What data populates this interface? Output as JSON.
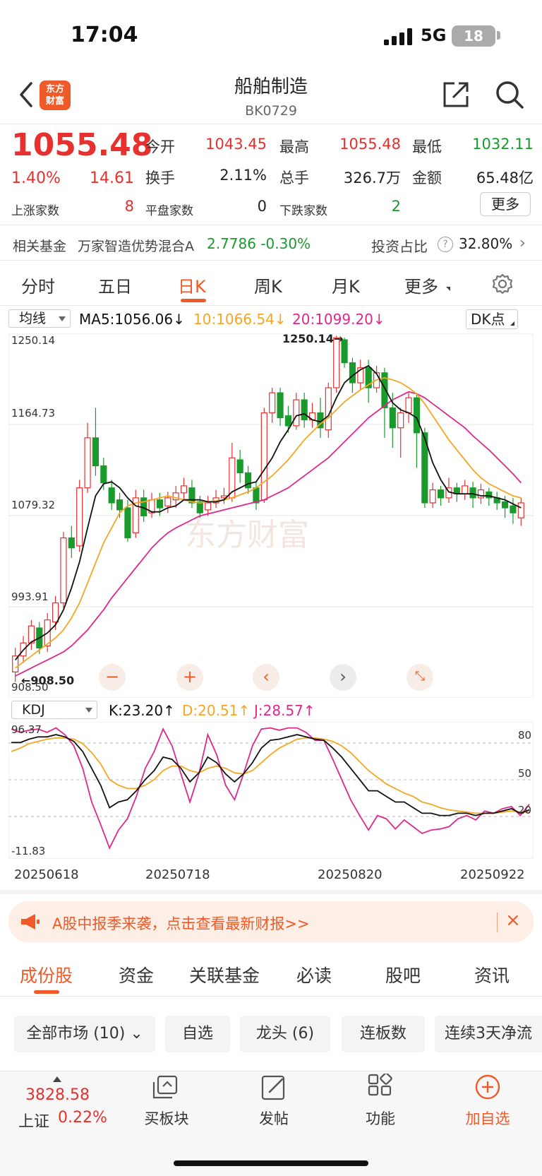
{
  "status": {
    "time": "17:04",
    "network": "5G",
    "battery": "18"
  },
  "header": {
    "title": "船舶制造",
    "code": "BK0729",
    "logo_line1": "东方",
    "logo_line2": "财富"
  },
  "quote": {
    "price": "1055.48",
    "change_pct": "1.40%",
    "change": "14.61",
    "open_label": "今开",
    "open": "1043.45",
    "high_label": "最高",
    "high": "1055.48",
    "low_label": "最低",
    "low": "1032.11",
    "turnover_label": "换手",
    "turnover": "2.11%",
    "volume_label": "总手",
    "volume": "326.7万",
    "amount_label": "金额",
    "amount": "65.48亿",
    "up_label": "上涨家数",
    "up": "8",
    "flat_label": "平盘家数",
    "flat": "0",
    "down_label": "下跌家数",
    "down": "2",
    "more": "更多"
  },
  "fund": {
    "label": "相关基金",
    "name": "万家智造优势混合A",
    "value": "2.7786 -0.30%",
    "ratio_label": "投资占比",
    "ratio": "32.80%"
  },
  "period_tabs": [
    "分时",
    "五日",
    "日K",
    "周K",
    "月K",
    "更多"
  ],
  "chart": {
    "ma_select": "均线",
    "ma5": "MA5:1056.06↓",
    "ma10": "10:1066.54↓",
    "ma20": "20:1099.20↓",
    "dk": "DK点",
    "price_ticks": [
      "1250.14",
      "1164.73",
      "1079.32",
      "993.91",
      "908.50"
    ],
    "high_marker": "1250.14",
    "low_marker": "908.50",
    "kdj_select": "KDJ",
    "kdj_k": "K:23.20↑",
    "kdj_d": "D:20.51↑",
    "kdj_j": "J:28.57↑",
    "kdj_ticks": [
      "96.37",
      "-11.83"
    ],
    "kdj_levels": [
      "80",
      "50",
      "20"
    ],
    "dates": [
      "20250618",
      "20250718",
      "20250820",
      "20250922"
    ],
    "colors": {
      "up": "#e8302f",
      "down": "#1a9a2c",
      "ma5": "#111111",
      "ma10": "#f5a623",
      "ma20": "#e0288c"
    }
  },
  "chart_data": {
    "type": "candlestick",
    "ylim": [
      908.5,
      1250.14
    ],
    "high": 1250.14,
    "low": 908.5,
    "candles": [
      [
        916,
        932,
        906,
        940
      ],
      [
        932,
        945,
        925,
        952
      ],
      [
        945,
        962,
        938,
        968
      ],
      [
        960,
        940,
        934,
        966
      ],
      [
        942,
        968,
        936,
        975
      ],
      [
        966,
        985,
        958,
        992
      ],
      [
        985,
        1050,
        980,
        1056
      ],
      [
        1050,
        1040,
        1030,
        1062
      ],
      [
        1042,
        1100,
        1036,
        1108
      ],
      [
        1100,
        1150,
        1095,
        1165
      ],
      [
        1150,
        1122,
        1112,
        1180
      ],
      [
        1122,
        1105,
        1098,
        1130
      ],
      [
        1100,
        1085,
        1078,
        1108
      ],
      [
        1088,
        1078,
        1070,
        1095
      ],
      [
        1080,
        1050,
        1046,
        1088
      ],
      [
        1055,
        1090,
        1050,
        1098
      ],
      [
        1090,
        1072,
        1066,
        1098
      ],
      [
        1075,
        1088,
        1070,
        1095
      ],
      [
        1088,
        1080,
        1072,
        1095
      ],
      [
        1082,
        1090,
        1075,
        1096
      ],
      [
        1088,
        1095,
        1080,
        1102
      ],
      [
        1095,
        1102,
        1088,
        1110
      ],
      [
        1100,
        1085,
        1080,
        1108
      ],
      [
        1086,
        1075,
        1070,
        1092
      ],
      [
        1078,
        1085,
        1072,
        1092
      ],
      [
        1085,
        1090,
        1080,
        1098
      ],
      [
        1090,
        1092,
        1084,
        1100
      ],
      [
        1090,
        1130,
        1086,
        1145
      ],
      [
        1128,
        1115,
        1105,
        1138
      ],
      [
        1115,
        1100,
        1094,
        1122
      ],
      [
        1100,
        1085,
        1078,
        1106
      ],
      [
        1088,
        1175,
        1085,
        1180
      ],
      [
        1175,
        1195,
        1165,
        1200
      ],
      [
        1195,
        1170,
        1162,
        1200
      ],
      [
        1172,
        1162,
        1155,
        1182
      ],
      [
        1162,
        1188,
        1158,
        1195
      ],
      [
        1188,
        1168,
        1160,
        1195
      ],
      [
        1168,
        1175,
        1160,
        1185
      ],
      [
        1175,
        1160,
        1150,
        1190
      ],
      [
        1158,
        1200,
        1150,
        1205
      ],
      [
        1200,
        1250,
        1195,
        1252
      ],
      [
        1248,
        1225,
        1220,
        1250
      ],
      [
        1225,
        1205,
        1195,
        1230
      ],
      [
        1205,
        1220,
        1198,
        1228
      ],
      [
        1220,
        1200,
        1185,
        1228
      ],
      [
        1200,
        1215,
        1195,
        1222
      ],
      [
        1215,
        1180,
        1150,
        1220
      ],
      [
        1180,
        1160,
        1140,
        1195
      ],
      [
        1160,
        1175,
        1130,
        1180
      ],
      [
        1175,
        1190,
        1165,
        1195
      ],
      [
        1190,
        1155,
        1120,
        1195
      ],
      [
        1155,
        1085,
        1080,
        1160
      ],
      [
        1085,
        1098,
        1080,
        1105
      ],
      [
        1098,
        1090,
        1082,
        1102
      ],
      [
        1090,
        1100,
        1085,
        1110
      ],
      [
        1100,
        1094,
        1086,
        1105
      ],
      [
        1094,
        1102,
        1088,
        1108
      ],
      [
        1100,
        1090,
        1080,
        1106
      ],
      [
        1090,
        1098,
        1084,
        1104
      ],
      [
        1096,
        1090,
        1082,
        1100
      ],
      [
        1090,
        1085,
        1078,
        1096
      ],
      [
        1086,
        1080,
        1070,
        1092
      ],
      [
        1082,
        1075,
        1064,
        1090
      ],
      [
        1070,
        1085,
        1062,
        1090
      ]
    ],
    "ma5": [
      928,
      938,
      946,
      950,
      955,
      963,
      978,
      1000,
      1026,
      1060,
      1092,
      1104,
      1106,
      1100,
      1090,
      1082,
      1080,
      1076,
      1076,
      1080,
      1082,
      1088,
      1088,
      1088,
      1086,
      1086,
      1088,
      1096,
      1100,
      1104,
      1106,
      1118,
      1130,
      1146,
      1158,
      1172,
      1174,
      1168,
      1166,
      1172,
      1190,
      1205,
      1212,
      1218,
      1222,
      1214,
      1200,
      1185,
      1178,
      1175,
      1170,
      1150,
      1125,
      1108,
      1096,
      1094,
      1094,
      1094,
      1092,
      1092,
      1090,
      1088,
      1084,
      1080
    ],
    "ma10": [
      920,
      926,
      932,
      938,
      944,
      950,
      958,
      970,
      985,
      1005,
      1025,
      1045,
      1060,
      1075,
      1082,
      1085,
      1086,
      1088,
      1090,
      1092,
      1090,
      1088,
      1086,
      1085,
      1086,
      1087,
      1088,
      1090,
      1093,
      1096,
      1100,
      1106,
      1112,
      1120,
      1128,
      1138,
      1148,
      1156,
      1164,
      1170,
      1178,
      1186,
      1192,
      1198,
      1203,
      1208,
      1210,
      1208,
      1205,
      1200,
      1194,
      1184,
      1172,
      1160,
      1148,
      1138,
      1128,
      1118,
      1110,
      1104,
      1100,
      1096,
      1092,
      1090
    ],
    "ma20": [
      912,
      916,
      920,
      924,
      928,
      932,
      936,
      942,
      950,
      958,
      968,
      978,
      990,
      1000,
      1010,
      1020,
      1030,
      1040,
      1048,
      1055,
      1060,
      1064,
      1068,
      1072,
      1074,
      1076,
      1078,
      1080,
      1082,
      1084,
      1086,
      1088,
      1092,
      1096,
      1100,
      1106,
      1112,
      1118,
      1124,
      1130,
      1138,
      1146,
      1154,
      1162,
      1170,
      1176,
      1182,
      1188,
      1192,
      1196,
      1194,
      1190,
      1184,
      1178,
      1172,
      1166,
      1160,
      1152,
      1145,
      1138,
      1130,
      1122,
      1114,
      1105
    ],
    "kdj": {
      "ylim": [
        -11.83,
        96.37
      ],
      "k": [
        83,
        83,
        86,
        88,
        88,
        90,
        88,
        84,
        75,
        60,
        45,
        25,
        30,
        32,
        40,
        50,
        58,
        70,
        68,
        60,
        48,
        56,
        70,
        65,
        55,
        48,
        55,
        65,
        78,
        85,
        86,
        88,
        90,
        88,
        86,
        85,
        78,
        70,
        60,
        50,
        40,
        40,
        35,
        30,
        30,
        25,
        20,
        20,
        18,
        18,
        20,
        20,
        18,
        20,
        20,
        22,
        24,
        20,
        23
      ],
      "d": [
        75,
        78,
        82,
        84,
        86,
        87,
        87,
        86,
        82,
        74,
        64,
        50,
        45,
        42,
        42,
        45,
        50,
        58,
        62,
        62,
        58,
        56,
        60,
        62,
        60,
        56,
        55,
        58,
        65,
        72,
        78,
        82,
        86,
        87,
        87,
        86,
        84,
        80,
        74,
        66,
        58,
        52,
        46,
        42,
        38,
        35,
        30,
        28,
        25,
        23,
        22,
        21,
        20,
        20,
        20,
        21,
        22,
        21,
        21
      ],
      "j": [
        95,
        92,
        94,
        95,
        92,
        96,
        90,
        80,
        60,
        30,
        10,
        -11,
        5,
        15,
        35,
        60,
        75,
        95,
        80,
        55,
        30,
        55,
        90,
        72,
        45,
        32,
        55,
        80,
        95,
        96,
        94,
        96,
        96,
        92,
        85,
        85,
        68,
        50,
        32,
        18,
        5,
        18,
        15,
        6,
        14,
        8,
        2,
        5,
        6,
        8,
        15,
        18,
        14,
        22,
        20,
        24,
        26,
        18,
        28
      ]
    }
  },
  "banner": {
    "text": "A股中报季来袭，点击查看最新财报>>"
  },
  "content_tabs": [
    "成份股",
    "资金",
    "关联基金",
    "必读",
    "股吧",
    "资讯"
  ],
  "filters": [
    "全部市场 (10)",
    "自选",
    "龙头 (6)",
    "连板数",
    "连续3天净流"
  ],
  "bottom": {
    "index_value": "3828.58",
    "index_name": "上证",
    "index_pct": "0.22%",
    "nav": [
      "买板块",
      "发帖",
      "功能",
      "加自选"
    ]
  }
}
